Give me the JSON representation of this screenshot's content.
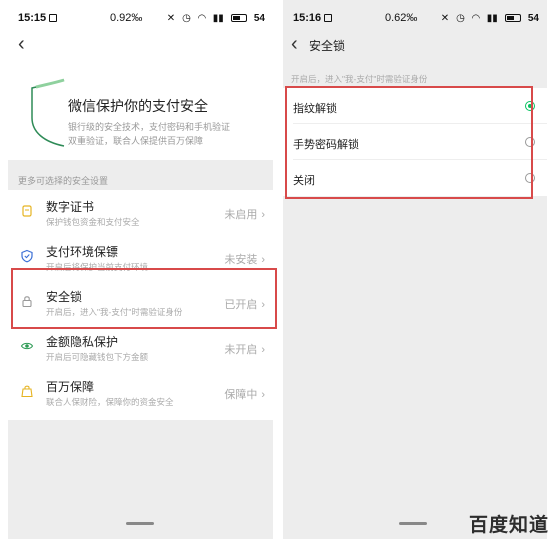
{
  "left": {
    "status_bar": {
      "time": "15:15",
      "speed": "0.92‰",
      "battery": "54"
    },
    "hero": {
      "title": "微信保护你的支付安全",
      "desc_line1": "银行级的安全技术，支付密码和手机验证",
      "desc_line2": "双重验证，联合人保提供百万保障"
    },
    "section_label": "更多可选择的安全设置",
    "items": [
      {
        "title": "数字证书",
        "subtitle": "保护钱包资金和支付安全",
        "status": "未启用",
        "icon": "certificate-icon"
      },
      {
        "title": "支付环境保镖",
        "subtitle": "开启后将保护当前支付环境",
        "status": "未安装",
        "icon": "shield-check-icon"
      },
      {
        "title": "安全锁",
        "subtitle": "开启后，进入\"我-支付\"时需验证身份",
        "status": "已开启",
        "icon": "lock-icon"
      },
      {
        "title": "金额隐私保护",
        "subtitle": "开启后可隐藏钱包下方金额",
        "status": "未开启",
        "icon": "eye-icon"
      },
      {
        "title": "百万保障",
        "subtitle": "联合人保财险，保障你的资金安全",
        "status": "保障中",
        "icon": "bag-icon"
      }
    ]
  },
  "right": {
    "status_bar": {
      "time": "15:16",
      "speed": "0.62‰",
      "battery": "54"
    },
    "title": "安全锁",
    "hint": "开启后，进入\"我-支付\"时需验证身份",
    "options": [
      {
        "label": "指纹解锁",
        "checked": true
      },
      {
        "label": "手势密码解锁",
        "checked": false
      },
      {
        "label": "关闭",
        "checked": false
      }
    ]
  },
  "watermark": "百度知道",
  "colors": {
    "highlight_red": "#d84a4a",
    "wechat_green": "#07c160"
  }
}
